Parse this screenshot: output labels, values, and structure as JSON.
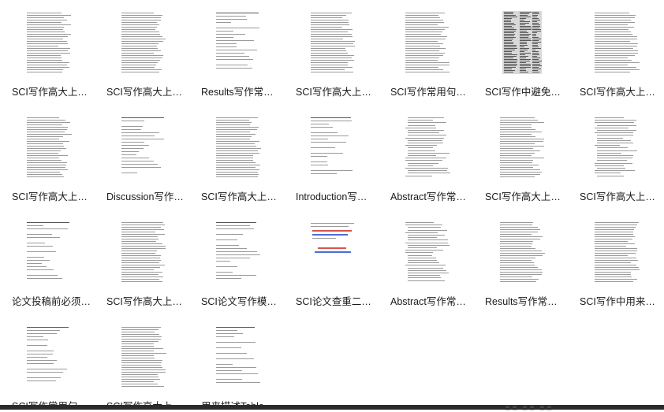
{
  "files": [
    {
      "name": "SCI写作高大上…",
      "thumb": "text"
    },
    {
      "name": "SCI写作高大上…",
      "thumb": "text"
    },
    {
      "name": "Results写作常…",
      "thumb": "sparse"
    },
    {
      "name": "SCI写作高大上…",
      "thumb": "text"
    },
    {
      "name": "SCI写作常用句…",
      "thumb": "text"
    },
    {
      "name": "SCI写作中避免…",
      "thumb": "photo"
    },
    {
      "name": "SCI写作高大上…",
      "thumb": "text"
    },
    {
      "name": "SCI写作高大上…",
      "thumb": "text"
    },
    {
      "name": "Discussion写作…",
      "thumb": "sparse"
    },
    {
      "name": "SCI写作高大上…",
      "thumb": "text"
    },
    {
      "name": "Introduction写…",
      "thumb": "sparse"
    },
    {
      "name": "Abstract写作常…",
      "thumb": "list"
    },
    {
      "name": "SCI写作高大上…",
      "thumb": "text"
    },
    {
      "name": "SCI写作高大上…",
      "thumb": "list"
    },
    {
      "name": "论文投稿前必须…",
      "thumb": "sparse"
    },
    {
      "name": "SCI写作高大上…",
      "thumb": "text"
    },
    {
      "name": "SCI论文写作模…",
      "thumb": "sparse"
    },
    {
      "name": "SCI论文查重二…",
      "thumb": "color"
    },
    {
      "name": "Abstract写作常…",
      "thumb": "list"
    },
    {
      "name": "Results写作常…",
      "thumb": "text"
    },
    {
      "name": "SCI写作中用来…",
      "thumb": "text"
    },
    {
      "name": "SCI写作常用句…",
      "thumb": "sparse"
    },
    {
      "name": "SCI写作高大上…",
      "thumb": "text"
    },
    {
      "name": "用来描述Table…",
      "thumb": "sparse"
    }
  ],
  "statusbar": {
    "text": "三三 三三 三三"
  }
}
